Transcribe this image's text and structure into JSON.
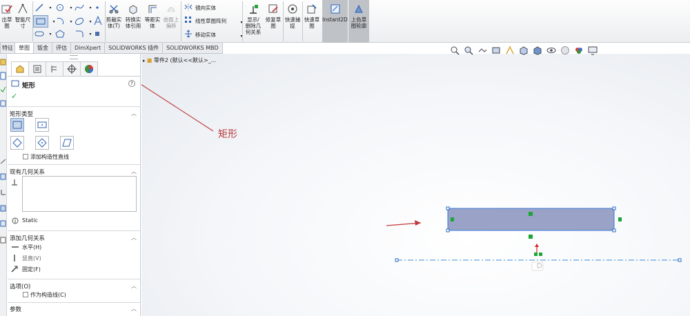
{
  "ribbon": {
    "exit_sketch": "出草\n图",
    "smart_dimension": "智能尺\n寸",
    "trim": "剪裁实\n体(T)",
    "convert": "转换实\n体引用",
    "offset": "等距实\n体",
    "surface_offset": "曲面上\n偏移",
    "mirror": "镜向实体",
    "linear_pattern": "线性草图阵列",
    "move": "移动实体",
    "show_delete_relations": "显示/\n删除几\n何关系",
    "repair": "修复草\n图",
    "quick_snaps": "快速捕\n捉",
    "rapid_sketch": "快速草\n图",
    "instant2d": "Instant2D",
    "shaded_contours": "上色草\n图轮廓"
  },
  "tabs": [
    "特征",
    "草图",
    "钣金",
    "评估",
    "DimXpert",
    "SOLIDWORKS 插件",
    "SOLIDWORKS MBD"
  ],
  "active_tab": 1,
  "pm": {
    "title": "矩形",
    "help": "?",
    "ok": "✓",
    "rect_type_header": "矩形类型",
    "add_construction": "添加构造性直线",
    "existing_header": "现有几何关系",
    "status": "Static",
    "add_rel_header": "添加几何关系",
    "rel_horizontal": "水平(H)",
    "rel_vertical": "竖直(V)",
    "rel_fix": "固定(F)",
    "options_header": "选项(O)",
    "as_construction": "作为构造线(C)",
    "params_header": "参数"
  },
  "gfx": {
    "breadcrumb": "零件2 (默认<<默认>_...",
    "annotation": "矩形"
  },
  "colors": {
    "rect_fill": "#9aa3c7",
    "rect_edge": "#3b7ad8",
    "annotation_red": "#b9373a",
    "centerline": "#3a8dd6",
    "constraint_green": "#1ea53a"
  }
}
